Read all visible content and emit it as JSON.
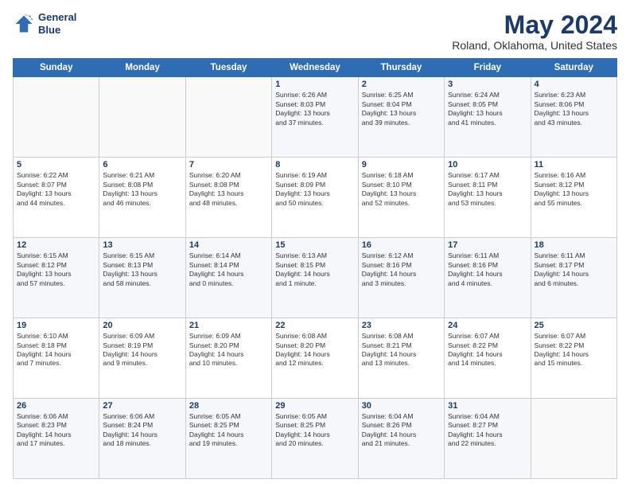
{
  "header": {
    "logo_line1": "General",
    "logo_line2": "Blue",
    "month": "May 2024",
    "location": "Roland, Oklahoma, United States"
  },
  "weekdays": [
    "Sunday",
    "Monday",
    "Tuesday",
    "Wednesday",
    "Thursday",
    "Friday",
    "Saturday"
  ],
  "weeks": [
    [
      {
        "day": "",
        "info": ""
      },
      {
        "day": "",
        "info": ""
      },
      {
        "day": "",
        "info": ""
      },
      {
        "day": "1",
        "info": "Sunrise: 6:26 AM\nSunset: 8:03 PM\nDaylight: 13 hours\nand 37 minutes."
      },
      {
        "day": "2",
        "info": "Sunrise: 6:25 AM\nSunset: 8:04 PM\nDaylight: 13 hours\nand 39 minutes."
      },
      {
        "day": "3",
        "info": "Sunrise: 6:24 AM\nSunset: 8:05 PM\nDaylight: 13 hours\nand 41 minutes."
      },
      {
        "day": "4",
        "info": "Sunrise: 6:23 AM\nSunset: 8:06 PM\nDaylight: 13 hours\nand 43 minutes."
      }
    ],
    [
      {
        "day": "5",
        "info": "Sunrise: 6:22 AM\nSunset: 8:07 PM\nDaylight: 13 hours\nand 44 minutes."
      },
      {
        "day": "6",
        "info": "Sunrise: 6:21 AM\nSunset: 8:08 PM\nDaylight: 13 hours\nand 46 minutes."
      },
      {
        "day": "7",
        "info": "Sunrise: 6:20 AM\nSunset: 8:08 PM\nDaylight: 13 hours\nand 48 minutes."
      },
      {
        "day": "8",
        "info": "Sunrise: 6:19 AM\nSunset: 8:09 PM\nDaylight: 13 hours\nand 50 minutes."
      },
      {
        "day": "9",
        "info": "Sunrise: 6:18 AM\nSunset: 8:10 PM\nDaylight: 13 hours\nand 52 minutes."
      },
      {
        "day": "10",
        "info": "Sunrise: 6:17 AM\nSunset: 8:11 PM\nDaylight: 13 hours\nand 53 minutes."
      },
      {
        "day": "11",
        "info": "Sunrise: 6:16 AM\nSunset: 8:12 PM\nDaylight: 13 hours\nand 55 minutes."
      }
    ],
    [
      {
        "day": "12",
        "info": "Sunrise: 6:15 AM\nSunset: 8:12 PM\nDaylight: 13 hours\nand 57 minutes."
      },
      {
        "day": "13",
        "info": "Sunrise: 6:15 AM\nSunset: 8:13 PM\nDaylight: 13 hours\nand 58 minutes."
      },
      {
        "day": "14",
        "info": "Sunrise: 6:14 AM\nSunset: 8:14 PM\nDaylight: 14 hours\nand 0 minutes."
      },
      {
        "day": "15",
        "info": "Sunrise: 6:13 AM\nSunset: 8:15 PM\nDaylight: 14 hours\nand 1 minute."
      },
      {
        "day": "16",
        "info": "Sunrise: 6:12 AM\nSunset: 8:16 PM\nDaylight: 14 hours\nand 3 minutes."
      },
      {
        "day": "17",
        "info": "Sunrise: 6:11 AM\nSunset: 8:16 PM\nDaylight: 14 hours\nand 4 minutes."
      },
      {
        "day": "18",
        "info": "Sunrise: 6:11 AM\nSunset: 8:17 PM\nDaylight: 14 hours\nand 6 minutes."
      }
    ],
    [
      {
        "day": "19",
        "info": "Sunrise: 6:10 AM\nSunset: 8:18 PM\nDaylight: 14 hours\nand 7 minutes."
      },
      {
        "day": "20",
        "info": "Sunrise: 6:09 AM\nSunset: 8:19 PM\nDaylight: 14 hours\nand 9 minutes."
      },
      {
        "day": "21",
        "info": "Sunrise: 6:09 AM\nSunset: 8:20 PM\nDaylight: 14 hours\nand 10 minutes."
      },
      {
        "day": "22",
        "info": "Sunrise: 6:08 AM\nSunset: 8:20 PM\nDaylight: 14 hours\nand 12 minutes."
      },
      {
        "day": "23",
        "info": "Sunrise: 6:08 AM\nSunset: 8:21 PM\nDaylight: 14 hours\nand 13 minutes."
      },
      {
        "day": "24",
        "info": "Sunrise: 6:07 AM\nSunset: 8:22 PM\nDaylight: 14 hours\nand 14 minutes."
      },
      {
        "day": "25",
        "info": "Sunrise: 6:07 AM\nSunset: 8:22 PM\nDaylight: 14 hours\nand 15 minutes."
      }
    ],
    [
      {
        "day": "26",
        "info": "Sunrise: 6:06 AM\nSunset: 8:23 PM\nDaylight: 14 hours\nand 17 minutes."
      },
      {
        "day": "27",
        "info": "Sunrise: 6:06 AM\nSunset: 8:24 PM\nDaylight: 14 hours\nand 18 minutes."
      },
      {
        "day": "28",
        "info": "Sunrise: 6:05 AM\nSunset: 8:25 PM\nDaylight: 14 hours\nand 19 minutes."
      },
      {
        "day": "29",
        "info": "Sunrise: 6:05 AM\nSunset: 8:25 PM\nDaylight: 14 hours\nand 20 minutes."
      },
      {
        "day": "30",
        "info": "Sunrise: 6:04 AM\nSunset: 8:26 PM\nDaylight: 14 hours\nand 21 minutes."
      },
      {
        "day": "31",
        "info": "Sunrise: 6:04 AM\nSunset: 8:27 PM\nDaylight: 14 hours\nand 22 minutes."
      },
      {
        "day": "",
        "info": ""
      }
    ]
  ]
}
